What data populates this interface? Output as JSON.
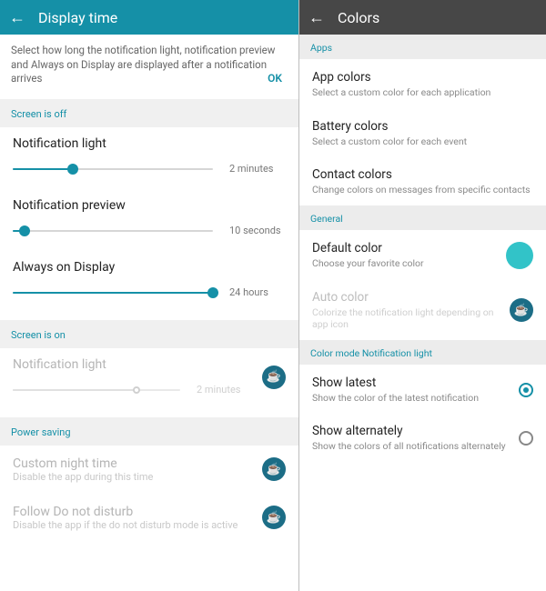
{
  "left": {
    "title": "Display time",
    "description": "Select how long the notification light, notification preview and Always on Display are displayed after a notification arrives",
    "ok": "OK",
    "sections": {
      "screen_off": "Screen is off",
      "screen_on": "Screen is on",
      "power_saving": "Power saving"
    },
    "sliders": {
      "notif_light": {
        "title": "Notification light",
        "value": "2 minutes",
        "pct": 30
      },
      "notif_preview": {
        "title": "Notification preview",
        "value": "10 seconds",
        "pct": 6
      },
      "always_on": {
        "title": "Always on Display",
        "value": "24 hours",
        "pct": 100
      },
      "notif_light_on": {
        "title": "Notification light",
        "value": "2 minutes",
        "pct": 74
      }
    },
    "items": {
      "custom_night": {
        "title": "Custom night time",
        "sub": "Disable the app during this time"
      },
      "follow_dnd": {
        "title": "Follow Do not disturb",
        "sub": "Disable the app if the do not disturb mode is active"
      }
    }
  },
  "right": {
    "title": "Colors",
    "sections": {
      "apps": "Apps",
      "general": "General",
      "color_mode": "Color mode Notification light"
    },
    "items": {
      "app_colors": {
        "title": "App colors",
        "sub": "Select a custom color for each application"
      },
      "battery_colors": {
        "title": "Battery colors",
        "sub": "Select a custom color for each event"
      },
      "contact_colors": {
        "title": "Contact colors",
        "sub": "Change colors on messages from specific contacts"
      },
      "default_color": {
        "title": "Default color",
        "sub": "Choose your favorite color"
      },
      "auto_color": {
        "title": "Auto color",
        "sub": "Colorize the notification light depending on app icon"
      },
      "show_latest": {
        "title": "Show latest",
        "sub": "Show the color of the latest notification"
      },
      "show_alternately": {
        "title": "Show alternately",
        "sub": "Show the colors of all notifications alternately"
      }
    }
  }
}
